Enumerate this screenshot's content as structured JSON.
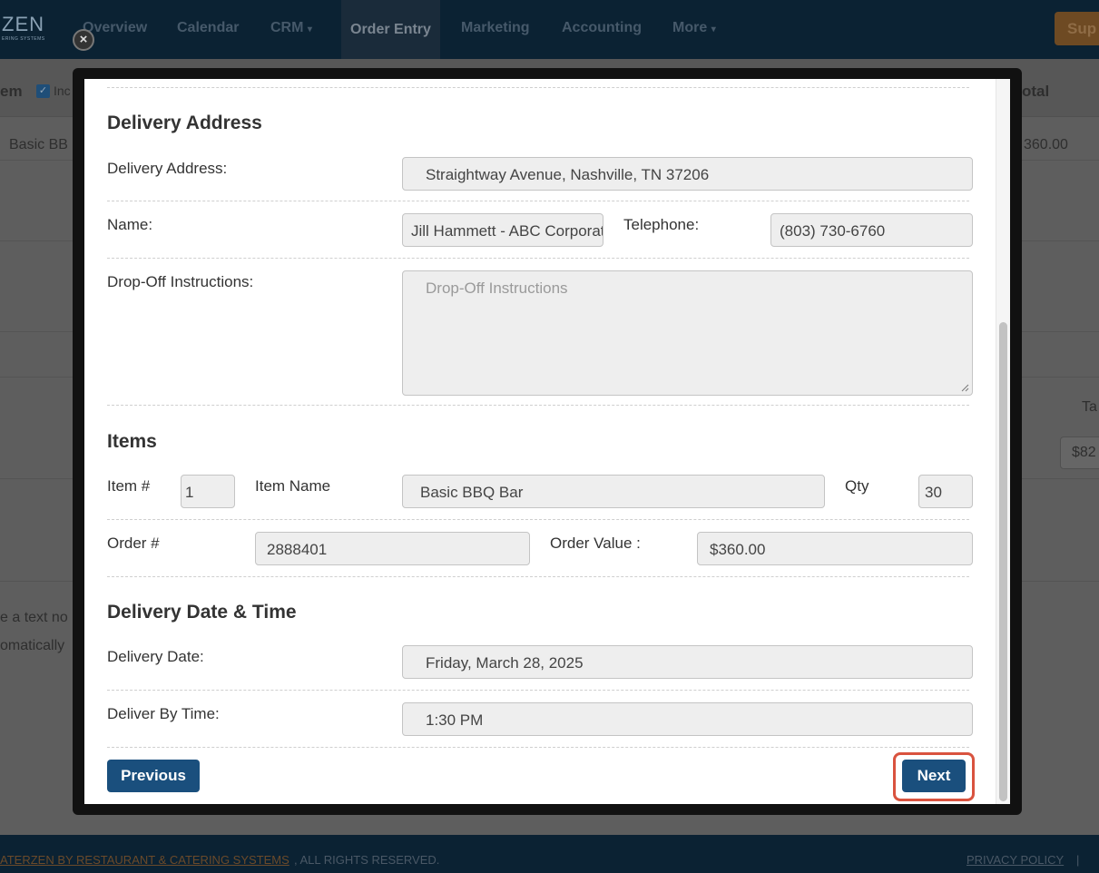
{
  "nav": {
    "logo_text": "ZEN",
    "logo_sub": "ERING SYSTEMS",
    "items": [
      "Overview",
      "Calendar",
      "CRM",
      "Order Entry",
      "Marketing",
      "Accounting",
      "More"
    ],
    "support_label": "Sup"
  },
  "background": {
    "item_header": "em",
    "include_label": "Inc",
    "total_header": "otal",
    "row_item": "Basic BB",
    "row_total": "360.00",
    "tax_header": "Ta",
    "tax_value": "$82",
    "note_line1": "e a text no",
    "note_line2": "omatically"
  },
  "footer": {
    "link_text": "ATERZEN BY RESTAURANT & CATERING SYSTEMS",
    "rights_text": ", ALL RIGHTS RESERVED.",
    "privacy": "PRIVACY POLICY",
    "sep": "|"
  },
  "modal": {
    "close_glyph": "×",
    "delivery_address_section": {
      "title": "Delivery Address",
      "address_label": "Delivery Address:",
      "address_value": "Straightway Avenue, Nashville, TN 37206",
      "name_label": "Name:",
      "name_value": "Jill Hammett - ABC Corporation",
      "telephone_label": "Telephone:",
      "telephone_value": "(803) 730-6760",
      "dropoff_label": "Drop-Off Instructions:",
      "dropoff_placeholder": "Drop-Off Instructions"
    },
    "items_section": {
      "title": "Items",
      "item_num_label": "Item #",
      "item_num_value": "1",
      "item_name_label": "Item Name",
      "item_name_value": "Basic BBQ Bar",
      "qty_label": "Qty",
      "qty_value": "30",
      "order_num_label": "Order #",
      "order_num_value": "2888401",
      "order_value_label": "Order Value :",
      "order_value_value": "$360.00"
    },
    "delivery_time_section": {
      "title": "Delivery Date & Time",
      "date_label": "Delivery Date:",
      "date_value": "Friday, March 28, 2025",
      "time_label": "Deliver By Time:",
      "time_value": "1:30 PM"
    },
    "buttons": {
      "previous": "Previous",
      "next": "Next"
    }
  }
}
